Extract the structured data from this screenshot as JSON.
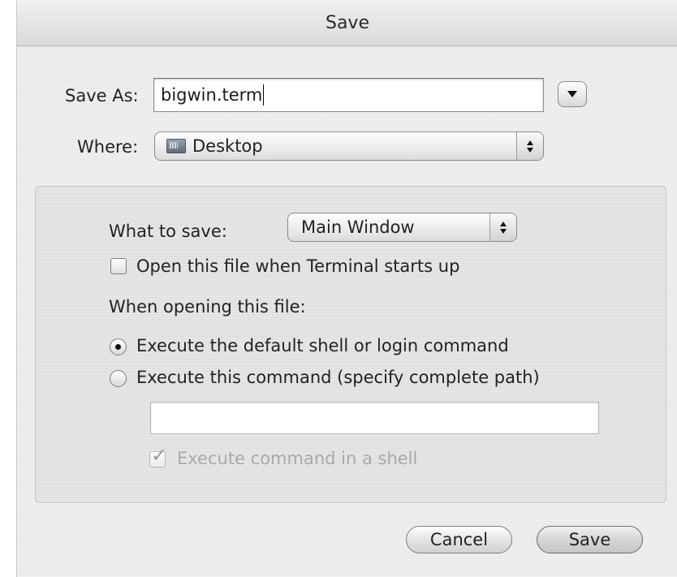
{
  "window": {
    "title": "Save"
  },
  "save_as": {
    "label": "Save As:",
    "value": "bigwin.term"
  },
  "where": {
    "label": "Where:",
    "selected": "Desktop",
    "icon": "folder-icon"
  },
  "options": {
    "what_to_save_label": "What to save:",
    "what_to_save_selected": "Main Window",
    "open_on_startup": {
      "label": "Open this file when Terminal starts up",
      "checked": false
    },
    "when_opening_label": "When opening this file:",
    "radio_default": {
      "label": "Execute the default shell or login command",
      "selected": true
    },
    "radio_command": {
      "label": "Execute this command (specify complete path)",
      "selected": false
    },
    "command_field": {
      "value": ""
    },
    "execute_in_shell": {
      "label": "Execute command in a shell",
      "checked": true,
      "enabled": false
    }
  },
  "buttons": {
    "cancel": "Cancel",
    "save": "Save"
  }
}
